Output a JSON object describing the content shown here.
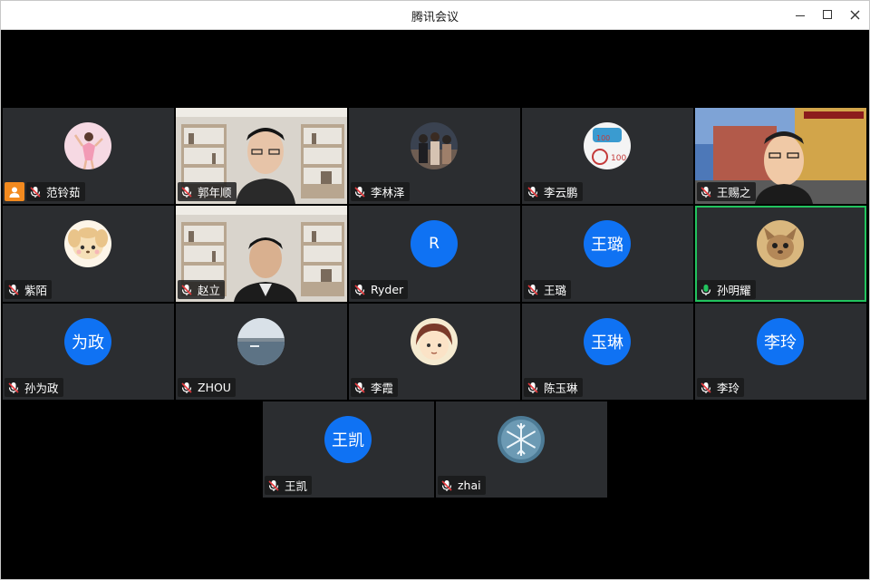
{
  "window": {
    "title": "腾讯会议"
  },
  "participants": [
    {
      "name": "范铃茹",
      "mic": "muted",
      "avatar": "photo-girl",
      "host": true
    },
    {
      "name": "郭年顺",
      "mic": "muted",
      "avatar": "video"
    },
    {
      "name": "李林泽",
      "mic": "muted",
      "avatar": "photo-group"
    },
    {
      "name": "李云鹏",
      "mic": "muted",
      "avatar": "photo-logo"
    },
    {
      "name": "王赐之",
      "mic": "muted",
      "avatar": "video"
    },
    {
      "name": "紫陌",
      "mic": "muted",
      "avatar": "cartoon-dog"
    },
    {
      "name": "赵立",
      "mic": "muted",
      "avatar": "video"
    },
    {
      "name": "Ryder",
      "mic": "muted",
      "avatar": "text",
      "avatar_text": "R"
    },
    {
      "name": "王璐",
      "mic": "muted",
      "avatar": "text",
      "avatar_text": "王璐"
    },
    {
      "name": "孙明耀",
      "mic": "speaking",
      "avatar": "photo-cat",
      "active": true
    },
    {
      "name": "孙为政",
      "mic": "muted",
      "avatar": "text",
      "avatar_text": "为政"
    },
    {
      "name": "ZHOU",
      "mic": "muted",
      "avatar": "photo-lake"
    },
    {
      "name": "李霞",
      "mic": "muted",
      "avatar": "cartoon-girl"
    },
    {
      "name": "陈玉琳",
      "mic": "muted",
      "avatar": "text",
      "avatar_text": "玉琳"
    },
    {
      "name": "李玲",
      "mic": "muted",
      "avatar": "text",
      "avatar_text": "李玲"
    },
    {
      "name": "王凯",
      "mic": "muted",
      "avatar": "text",
      "avatar_text": "王凯"
    },
    {
      "name": "zhai",
      "mic": "muted",
      "avatar": "photo-snowflake"
    }
  ],
  "colors": {
    "tile_bg": "#2b2d30",
    "avatar_blue": "#0f72f3",
    "speaking_green": "#22c35e",
    "muted_red": "#e5393d",
    "host_orange": "#f28a1f"
  }
}
